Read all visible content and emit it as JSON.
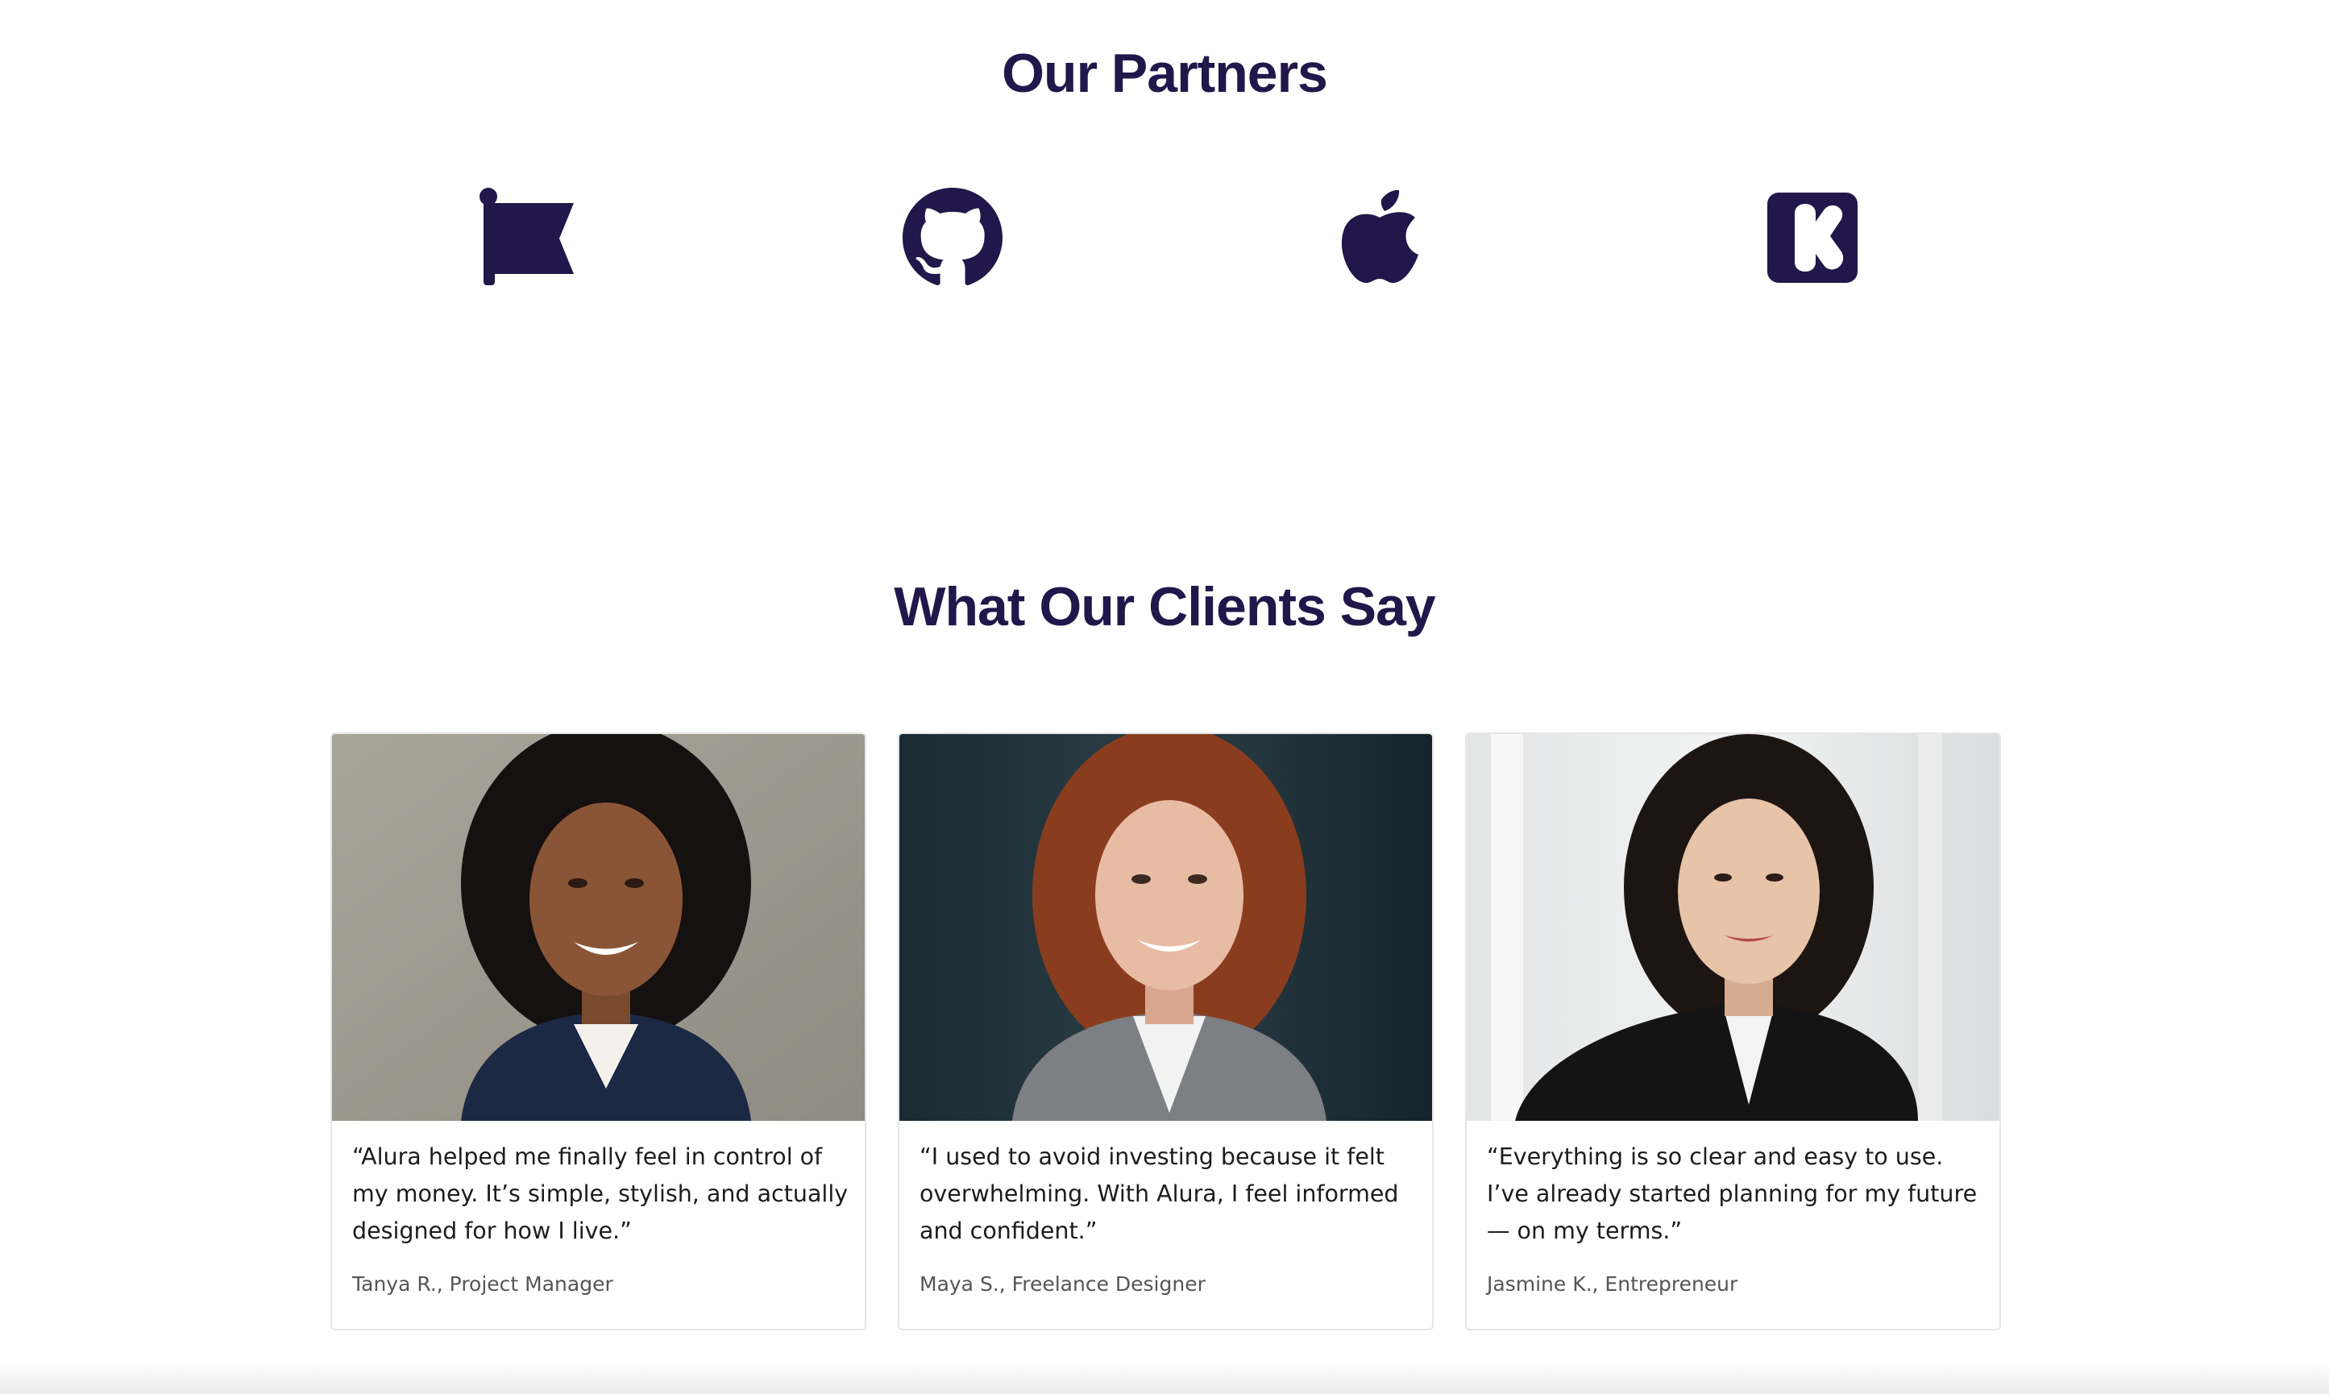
{
  "partners": {
    "title": "Our Partners",
    "logos": [
      {
        "icon": "flag-icon"
      },
      {
        "icon": "github-icon"
      },
      {
        "icon": "apple-icon"
      },
      {
        "icon": "kickstarter-icon"
      }
    ],
    "logo_color": "#22174a"
  },
  "testimonials": {
    "title": "What Our Clients Say",
    "cards": [
      {
        "quote": "“Alura helped me finally feel in control of my money. It’s simple, stylish, and actually designed for how I live.”",
        "author": "Tanya R., Project Manager"
      },
      {
        "quote": "“I used to avoid investing because it felt overwhelming. With Alura, I feel informed and confident.”",
        "author": "Maya S., Freelance Designer"
      },
      {
        "quote": "“Everything is so clear and easy to use. I’ve already started planning for my future — on my terms.”",
        "author": "Jasmine K., Entrepreneur"
      }
    ]
  }
}
